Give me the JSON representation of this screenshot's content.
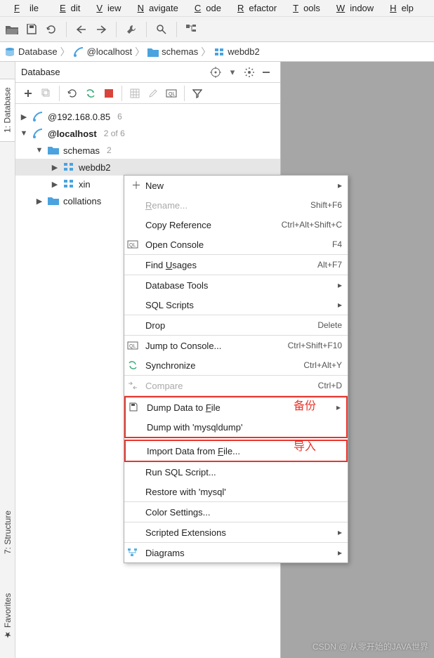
{
  "menu": [
    "File",
    "Edit",
    "View",
    "Navigate",
    "Code",
    "Refactor",
    "Tools",
    "Window",
    "Help"
  ],
  "nav": {
    "a": "Database",
    "b": "@localhost",
    "c": "schemas",
    "d": "webdb2"
  },
  "panel": {
    "title": "Database"
  },
  "tree": {
    "n1": "@192.168.0.85",
    "n1c": "6",
    "n2": "@localhost",
    "n2c": "2 of 6",
    "n3": "schemas",
    "n3c": "2",
    "n4": "webdb2",
    "n5": "xin",
    "n6": "collations"
  },
  "ctx": {
    "new": "New",
    "rename": "Rename...",
    "rename_kb": "Shift+F6",
    "copyref": "Copy Reference",
    "copyref_kb": "Ctrl+Alt+Shift+C",
    "opencons": "Open Console",
    "opencons_kb": "F4",
    "findus": "Find Usages",
    "findus_kb": "Alt+F7",
    "dbtools": "Database Tools",
    "sqlsc": "SQL Scripts",
    "drop": "Drop",
    "drop_kb": "Delete",
    "jumpcons": "Jump to Console...",
    "jumpcons_kb": "Ctrl+Shift+F10",
    "sync": "Synchronize",
    "sync_kb": "Ctrl+Alt+Y",
    "compare": "Compare",
    "compare_kb": "Ctrl+D",
    "dump": "Dump Data to File",
    "dump2": "Dump with 'mysqldump'",
    "import": "Import Data from File...",
    "runsql": "Run SQL Script...",
    "restore": "Restore with 'mysql'",
    "colors": "Color Settings...",
    "scripted": "Scripted Extensions",
    "diagrams": "Diagrams"
  },
  "annotations": {
    "backup": "备份",
    "import": "导入"
  },
  "left_tabs": {
    "db": "1: Database",
    "st": "7: Structure",
    "fv": "Favorites"
  },
  "watermark": "CSDN @ 从零开始的JAVA世界"
}
